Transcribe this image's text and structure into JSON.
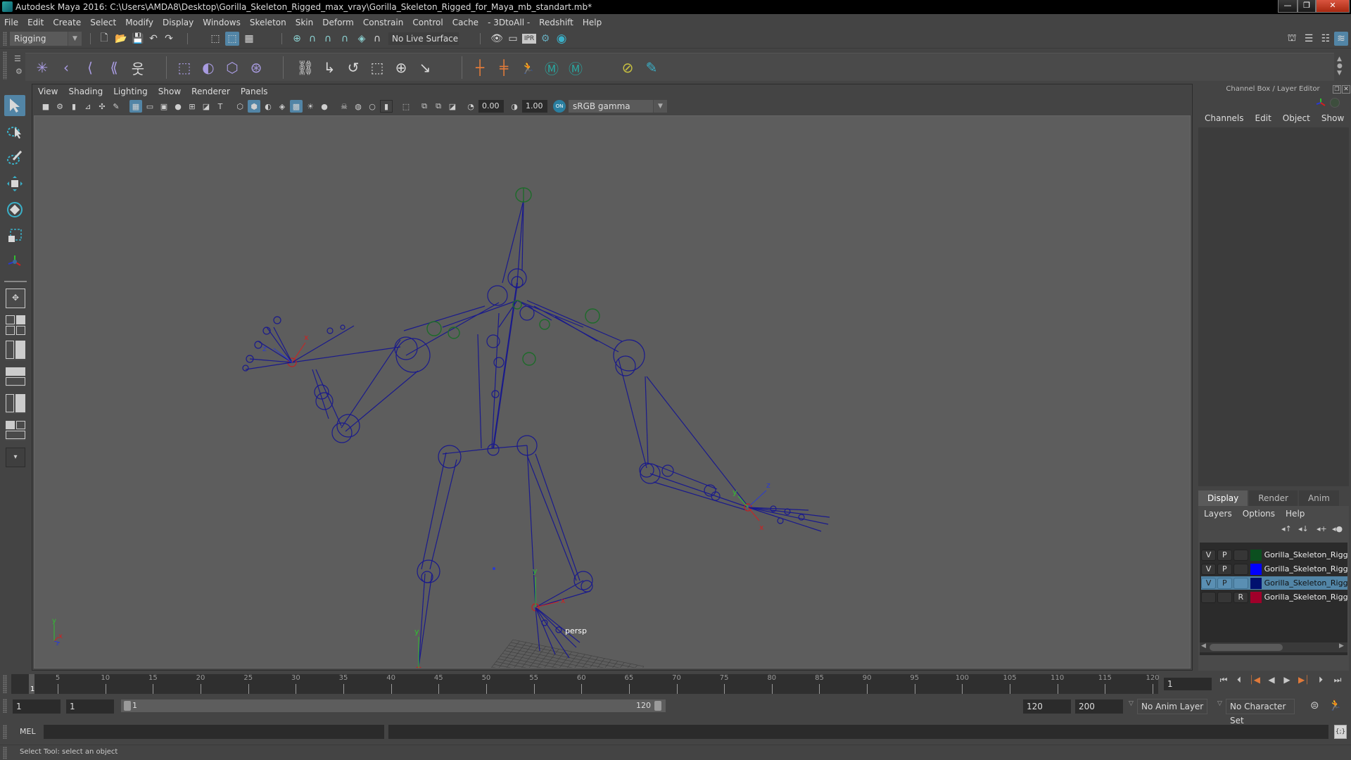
{
  "window": {
    "title": "Autodesk Maya 2016: C:\\Users\\AMDA8\\Desktop\\Gorilla_Skeleton_Rigged_max_vray\\Gorilla_Skeleton_Rigged_for_Maya_mb_standart.mb*",
    "minimize": "—",
    "maximize": "❐",
    "close": "✕"
  },
  "menubar": [
    "File",
    "Edit",
    "Create",
    "Select",
    "Modify",
    "Display",
    "Windows",
    "Skeleton",
    "Skin",
    "Deform",
    "Constrain",
    "Control",
    "Cache",
    "- 3DtoAll -",
    "Redshift",
    "Help"
  ],
  "statusline": {
    "menu_set": "Rigging",
    "live_surface": "No Live Surface",
    "icons": [
      "new-scene-icon",
      "open-scene-icon",
      "save-scene-icon",
      "undo-icon",
      "redo-icon",
      "select-by-hierarchy-icon",
      "select-by-object-icon",
      "select-by-component-icon",
      "snap-to-grid-icon",
      "snap-to-curve-icon",
      "snap-to-point-icon",
      "snap-to-view-plane-icon",
      "snap-to-projected-center-icon",
      "make-live-icon",
      "render-view-icon",
      "render-current-frame-icon",
      "ipr-render-icon",
      "render-settings-icon",
      "hypershade-icon"
    ],
    "ipr_label": "IPR"
  },
  "shelf": {
    "tools": [
      "joint-tool-icon",
      "insert-joint-icon",
      "mirror-joint-icon",
      "ik-handle-icon",
      "humanik-icon",
      "bind-skin-icon",
      "interactive-bind-icon",
      "lattice-icon",
      "cluster-icon",
      "parent-constraint-icon",
      "point-constraint-icon",
      "orient-constraint-icon",
      "scale-constraint-icon",
      "aim-constraint-icon",
      "pole-vector-icon",
      "locator-icon",
      "locator-constraint-icon",
      "character-icon",
      "maya-m-icon",
      "maya-m-alt-icon",
      "layer-off-icon",
      "lasso-paint-icon"
    ]
  },
  "toolbox": {
    "tools": [
      "select-tool-icon",
      "lasso-select-icon",
      "paint-select-icon",
      "move-tool-icon",
      "rotate-tool-icon",
      "scale-tool-icon",
      "show-manipulator-icon"
    ],
    "layouts": [
      "single-perspective-layout-icon",
      "four-view-layout-icon",
      "persp-outliner-layout-icon",
      "persp-graph-layout-icon",
      "hypershade-layout-icon",
      "persp-graph-hypergraph-layout-icon"
    ],
    "more": "▾"
  },
  "viewport": {
    "menu": [
      "View",
      "Shading",
      "Lighting",
      "Show",
      "Renderer",
      "Panels"
    ],
    "exposure": "0.00",
    "gamma": "1.00",
    "color_space": "sRGB gamma",
    "camera_label": "persp",
    "axis_labels": {
      "x": "x",
      "y": "y",
      "z": "z"
    }
  },
  "channelbox": {
    "title": "Channel Box / Layer Editor",
    "menu": [
      "Channels",
      "Edit",
      "Object",
      "Show"
    ]
  },
  "layer_editor": {
    "tabs": [
      "Display",
      "Render",
      "Anim"
    ],
    "active_tab": "Display",
    "menu": [
      "Layers",
      "Options",
      "Help"
    ],
    "layers": [
      {
        "v": "V",
        "p": "P",
        "r": "",
        "color": "#0b4f1f",
        "name": "Gorilla_Skeleton_Rigg",
        "selected": false
      },
      {
        "v": "V",
        "p": "P",
        "r": "",
        "color": "#0000ff",
        "name": "Gorilla_Skeleton_Rigg",
        "selected": false
      },
      {
        "v": "V",
        "p": "P",
        "r": "",
        "color": "#00106e",
        "name": "Gorilla_Skeleton_Rigg",
        "selected": true
      },
      {
        "v": "",
        "p": "",
        "r": "R",
        "color": "#a0002a",
        "name": "Gorilla_Skeleton_Rigg",
        "selected": false
      }
    ]
  },
  "timeline": {
    "ticks": [
      "5",
      "10",
      "15",
      "20",
      "25",
      "30",
      "35",
      "40",
      "45",
      "50",
      "55",
      "60",
      "65",
      "70",
      "75",
      "80",
      "85",
      "90",
      "95",
      "100",
      "105",
      "110",
      "115",
      "120"
    ],
    "current_frame_marker": "1",
    "current_frame_field": "1",
    "range_start": 1,
    "range_end": 120
  },
  "range": {
    "start_time": "1",
    "playback_start": "1",
    "slider_start_label": "1",
    "slider_end_label": "120",
    "playback_end": "120",
    "end_time": "200",
    "anim_layer": "No Anim Layer",
    "character_set": "No Character Set"
  },
  "command": {
    "language": "MEL",
    "input": "",
    "result": ""
  },
  "helpline": "Select Tool: select an object",
  "colors": {
    "accent": "#5285a6",
    "viewport_bg": "#5d5d5d",
    "skeleton": "#1a1a8c",
    "control_green": "#1d6b2a",
    "axis_x": "#d02020",
    "axis_y": "#30c030",
    "axis_z": "#2a3ad0",
    "playback_orange": "#e07a3a"
  }
}
